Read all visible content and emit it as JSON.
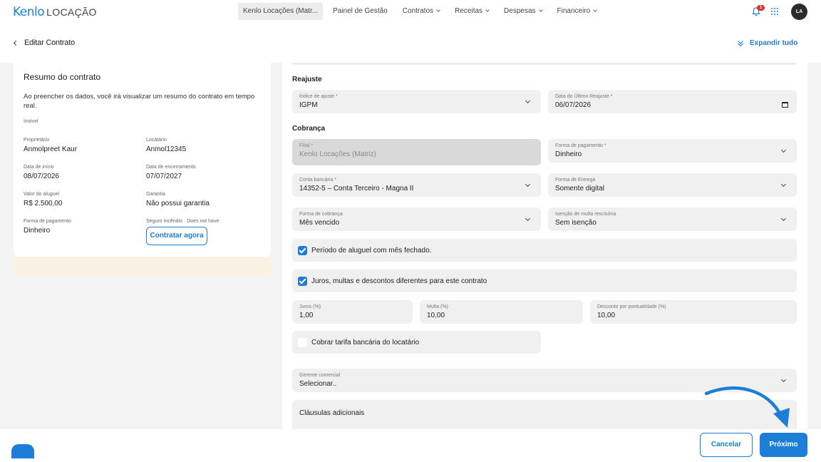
{
  "logo": {
    "brand": "Kenlo",
    "product": "LOCAÇÃO"
  },
  "nav": {
    "items": [
      {
        "label": "Kenlo Locações (Matr...",
        "has_dropdown": false,
        "active": true
      },
      {
        "label": "Painel de Gestão",
        "has_dropdown": false,
        "active": false
      },
      {
        "label": "Contratos",
        "has_dropdown": true,
        "active": false
      },
      {
        "label": "Receitas",
        "has_dropdown": true,
        "active": false
      },
      {
        "label": "Despesas",
        "has_dropdown": true,
        "active": false
      },
      {
        "label": "Financeiro",
        "has_dropdown": true,
        "active": false
      }
    ],
    "notification_count": "1",
    "avatar_initials": "LA"
  },
  "header": {
    "title": "Editar Contrato",
    "expand_label": "Expandir tudo"
  },
  "summary": {
    "title": "Resumo do contrato",
    "description": "Ao preencher os dados, você irá visualizar um resumo do contrato em tempo real.",
    "imovel_label": "Imóvel",
    "proprietario_label": "Proprietário",
    "proprietario_value": "Anmolpreet Kaur",
    "locatario_label": "Locatário",
    "locatario_value": "Anmol12345",
    "inicio_label": "Data de início",
    "inicio_value": "08/07/2026",
    "encerramento_label": "Data de encerramento",
    "encerramento_value": "07/07/2027",
    "aluguel_label": "Valor do aluguel",
    "aluguel_value": "R$ 2.500,00",
    "garantia_label": "Garantia",
    "garantia_value": "Não possui garantia",
    "pagamento_label": "Forma de pagamento",
    "pagamento_value": "Dinheiro",
    "seguro_label": "Seguro Incêndio · Does not have",
    "contratar_label": "Contratar agora"
  },
  "form": {
    "reajuste_title": "Reajuste",
    "indice_label": "Índice de ajuste *",
    "indice_value": "IGPM",
    "ultimo_reajuste_label": "Data do Último Reajuste *",
    "ultimo_reajuste_value": "06/07/2026",
    "cobranca_title": "Cobrança",
    "filial_label": "Filial *",
    "filial_value": "Kenlo Locações (Matriz)",
    "forma_pagamento_label": "Forma de pagamento *",
    "forma_pagamento_value": "Dinheiro",
    "conta_label": "Conta bancária *",
    "conta_value": "14352-5 – Conta Terceiro - Magna II",
    "entrega_label": "Forma de Entrega",
    "entrega_value": "Somente digital",
    "forma_cobranca_label": "Forma de cobrança",
    "forma_cobranca_value": "Mês vencido",
    "isencao_label": "Isenção de multa rescisória",
    "isencao_value": "Sem isenção",
    "periodo_label": "Período de aluguel com mês fechado.",
    "periodo_checked": true,
    "juros_diferentes_label": "Juros, multas e descontos diferentes para este contrato",
    "juros_diferentes_checked": true,
    "juros_label": "Juros (%)",
    "juros_value": "1,00",
    "multa_label": "Multa (%)",
    "multa_value": "10,00",
    "desconto_label": "Desconto por pontualidade (%)",
    "desconto_value": "10,00",
    "tarifa_label": "Cobrar tarifa bancária do locatário",
    "tarifa_checked": false,
    "gerente_label": "Gerente comercial",
    "gerente_value": "Selecionar..",
    "clausulas_label": "Cláusulas adicionais"
  },
  "footer": {
    "cancel_label": "Cancelar",
    "next_label": "Próximo"
  },
  "colors": {
    "accent": "#1c7ed6",
    "badge": "#e03131",
    "summary_footer": "#fbf1e3"
  }
}
